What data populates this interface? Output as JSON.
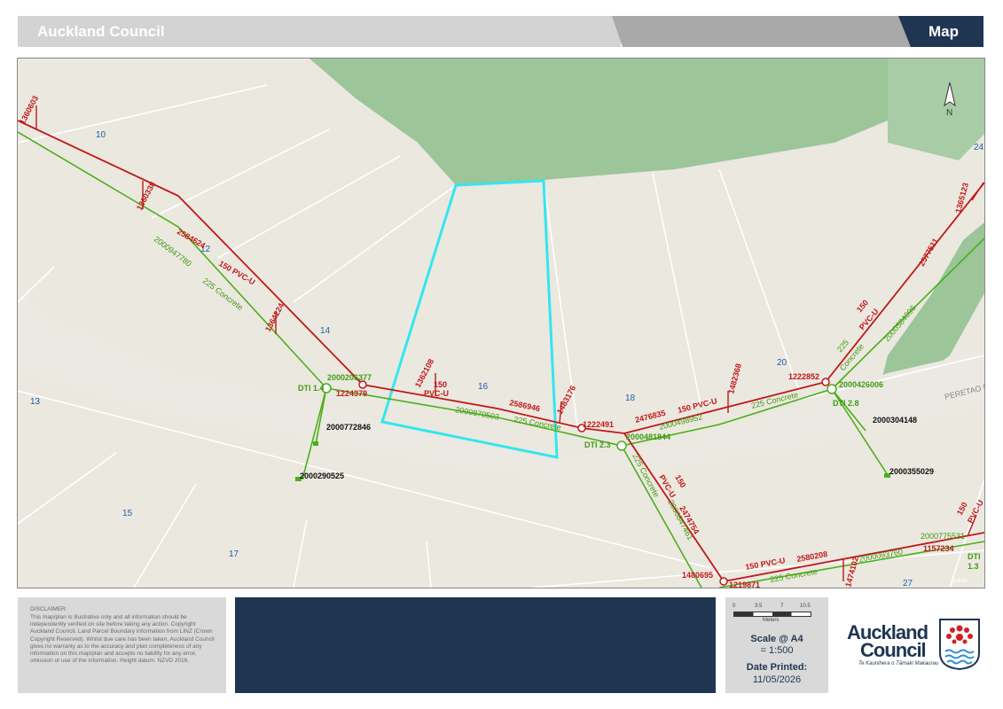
{
  "header": {
    "title": "Auckland Council",
    "section": "Map"
  },
  "colors": {
    "navy": "#1f3552",
    "boundary": "#33e6f0",
    "wastewater": "#c01818",
    "stormwater": "#4caf1a",
    "bush": "#9cc59a",
    "land": "#ebe8e0"
  },
  "map": {
    "north_label": "N",
    "property_numbers": [
      "10",
      "12",
      "14",
      "13",
      "15",
      "16",
      "17",
      "18",
      "20",
      "24",
      "27"
    ],
    "street_name": "PERETAO P",
    "watermark": "public",
    "wastewater_labels": [
      "1360603",
      "1360338",
      "2584624",
      "150 PVC-U",
      "1364224",
      "1224379",
      "1362108",
      "150",
      "PVC-U",
      "2586946",
      "1483176",
      "1222491",
      "2476835",
      "150 PVC-U",
      "1482368",
      "1222852",
      "150",
      "PVC-U",
      "2577511",
      "1365123",
      "150",
      "PVC-U",
      "2474754",
      "1480695",
      "1219871",
      "150 PVC-U",
      "2580208",
      "1474102",
      "1157234",
      "150",
      "PVC-U"
    ],
    "stormwater_labels": [
      "2000947780",
      "225 Concrete",
      "2000206377",
      "DTI 1.4",
      "2000870503",
      "225 Concrete",
      "DTI 2.3",
      "2000481844",
      "2000498952",
      "225 Concrete",
      "2000426006",
      "DTI 2.8",
      "225",
      "Concrete",
      "2000584096",
      "225 Concrete",
      "2000847461",
      "225 Concrete",
      "2000093760",
      "2000775531",
      "DTI",
      "1.3"
    ],
    "asset_labels": [
      "2000772846",
      "2000290525",
      "2000304148",
      "2000355029"
    ]
  },
  "footer": {
    "disclaimer_title": "DISCLAIMER:",
    "disclaimer_text": "This map/plan is illustrative only and all information should be independently verified on site before taking any action. Copyright Auckland Council. Land Parcel Boundary information from LINZ (Crown Copyright Reserved). Whilst due care has been taken, Auckland Council gives no warranty as to the accuracy and plan completeness of any information on this map/plan and accepts no liability for any error, omission or use of the information. Height datum: NZVD 2016.",
    "scale_ticks": [
      "0",
      "3.5",
      "7",
      "10.5"
    ],
    "scale_unit": "Meters",
    "scale_label": "Scale @ A4",
    "scale_value": "= 1:500",
    "printed_label": "Date Printed:",
    "printed_date": "11/05/2026",
    "logo_line1": "Auckland",
    "logo_line2": "Council",
    "logo_tagline": "Te Kaunihera o Tāmaki Makaurau"
  }
}
